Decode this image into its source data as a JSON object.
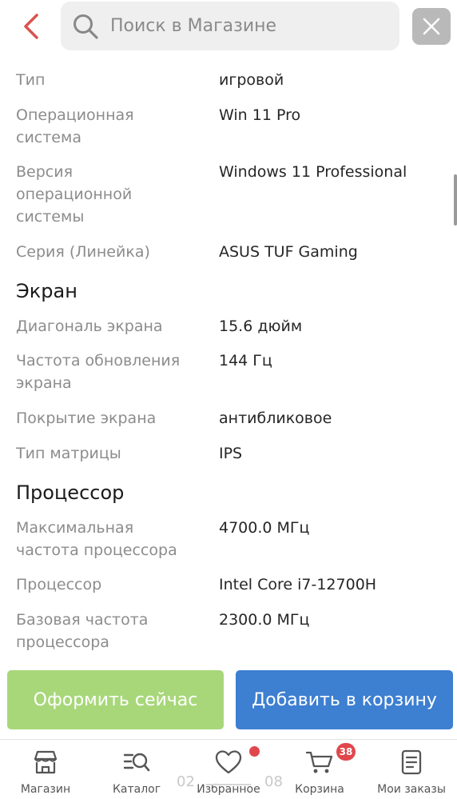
{
  "header": {
    "search_placeholder": "Поиск в Магазине"
  },
  "specs": {
    "general": [
      {
        "label": "Тип",
        "value": "игровой"
      },
      {
        "label": "Операционная система",
        "value": "Win 11 Pro"
      },
      {
        "label": "Версия операционной системы",
        "value": "Windows 11 Professional"
      },
      {
        "label": "Серия (Линейка)",
        "value": "ASUS TUF Gaming"
      }
    ],
    "screen_title": "Экран",
    "screen": [
      {
        "label": "Диагональ экрана",
        "value": "15.6 дюйм"
      },
      {
        "label": "Частота обновления экрана",
        "value": "144 Гц"
      },
      {
        "label": "Покрытие экрана",
        "value": "антибликовое"
      },
      {
        "label": "Тип матрицы",
        "value": "IPS"
      }
    ],
    "cpu_title": "Процессор",
    "cpu": [
      {
        "label": "Максимальная частота процессора",
        "value": "4700.0 МГц"
      },
      {
        "label": "Процессор",
        "value": "Intel Core i7-12700H"
      },
      {
        "label": "Базовая частота процессора",
        "value": "2300.0 МГц"
      }
    ]
  },
  "actions": {
    "buy_now": "Оформить сейчас",
    "add_to_cart": "Добавить в корзину"
  },
  "nav": {
    "shop": "Магазин",
    "catalog": "Каталог",
    "favorites": "Избранное",
    "cart": "Корзина",
    "orders": "Мои заказы",
    "cart_count": "38"
  },
  "pager": {
    "left": "02",
    "right": "08"
  },
  "colors": {
    "accent_red": "#e0474c",
    "buy_green": "#a8d77a",
    "cart_blue": "#3d7fd1"
  }
}
